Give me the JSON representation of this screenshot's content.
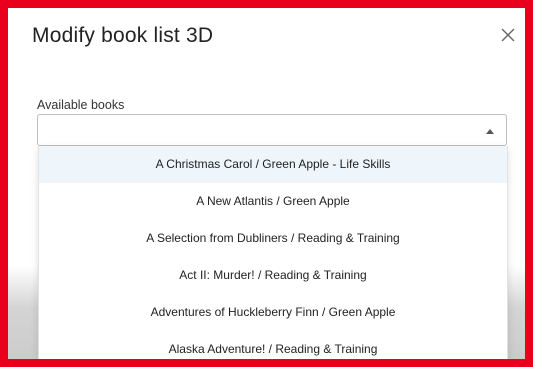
{
  "dialog": {
    "title": "Modify book list 3D",
    "close_icon": "close-icon"
  },
  "field": {
    "label": "Available books",
    "value": "",
    "caret_icon": "caret-up-icon"
  },
  "options": [
    {
      "label": "A Christmas Carol / Green Apple - Life Skills",
      "highlighted": true
    },
    {
      "label": "A New Atlantis / Green Apple",
      "highlighted": false
    },
    {
      "label": "A Selection from Dubliners / Reading & Training",
      "highlighted": false
    },
    {
      "label": "Act II: Murder! / Reading & Training",
      "highlighted": false
    },
    {
      "label": "Adventures of Huckleberry Finn / Green Apple",
      "highlighted": false
    },
    {
      "label": "Alaska Adventure! / Reading & Training",
      "highlighted": false
    }
  ],
  "colors": {
    "frame_border": "#e8001c",
    "highlight": "#eef5fb"
  }
}
